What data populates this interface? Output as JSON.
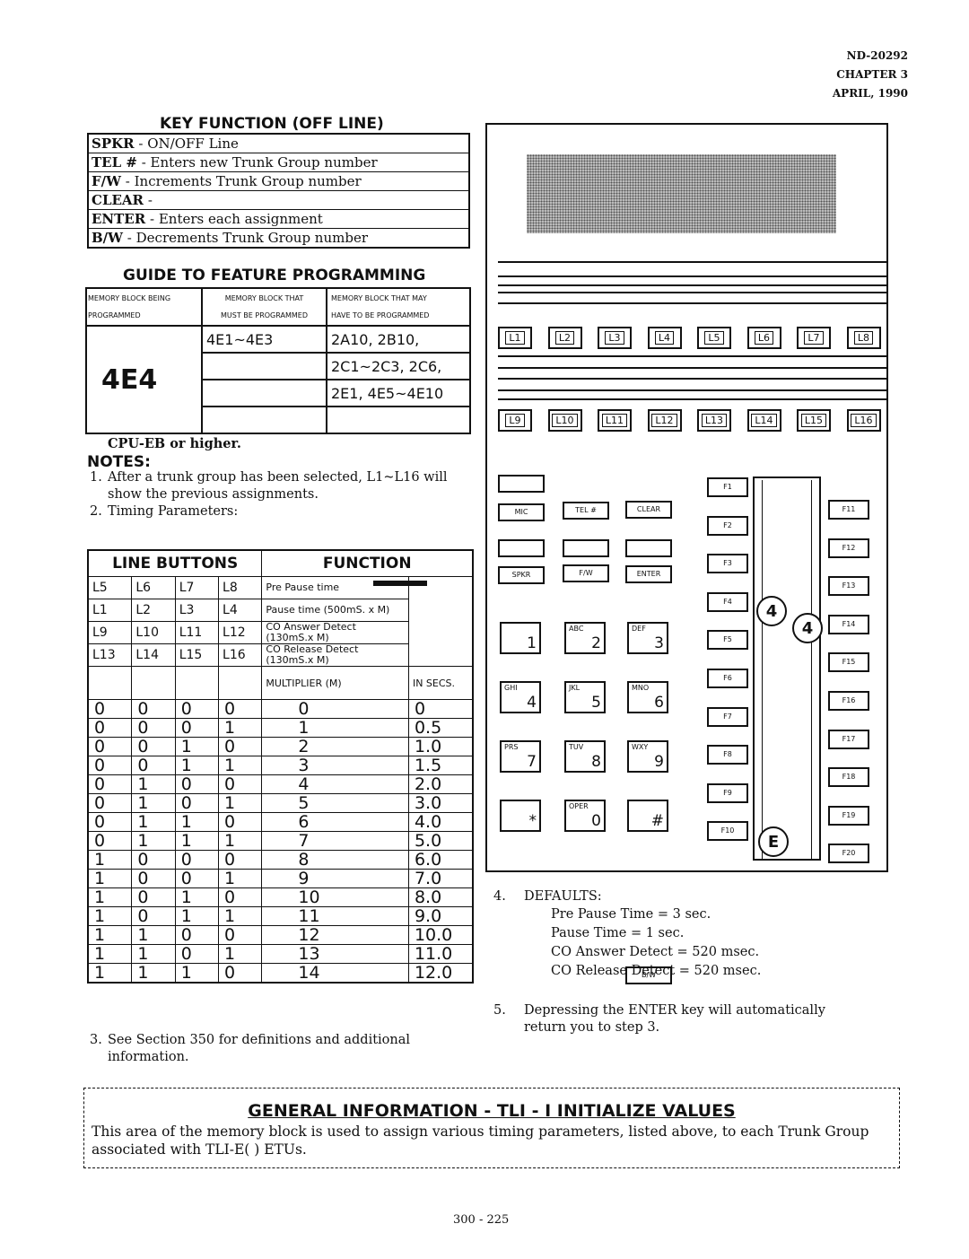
{
  "header": {
    "doc": "ND-20292",
    "chapter": "CHAPTER 3",
    "date": "APRIL, 1990"
  },
  "key_function": {
    "title": "KEY FUNCTION (OFF LINE)",
    "rows": [
      {
        "key": "SPKR",
        "desc": "- ON/OFF Line"
      },
      {
        "key": "TEL #",
        "desc": "- Enters new Trunk Group number"
      },
      {
        "key": "F/W",
        "desc": "- Increments Trunk Group number"
      },
      {
        "key": "CLEAR",
        "desc": "-"
      },
      {
        "key": "ENTER",
        "desc": "- Enters each assignment"
      },
      {
        "key": "B/W",
        "desc": "- Decrements Trunk Group number"
      }
    ]
  },
  "guide": {
    "title": "GUIDE TO FEATURE PROGRAMMING",
    "col1": [
      "MEMORY BLOCK BEING",
      "PROGRAMMED"
    ],
    "col2": [
      "MEMORY BLOCK THAT",
      "MUST BE PROGRAMMED"
    ],
    "col3": [
      "MEMORY BLOCK THAT MAY",
      "HAVE TO BE PROGRAMMED"
    ],
    "block": "4E4",
    "must": [
      "4E1~4E3",
      "",
      "",
      ""
    ],
    "may": [
      "2A10, 2B10,",
      "2C1~2C3, 2C6,",
      "2E1, 4E5~4E10",
      ""
    ]
  },
  "cpu_note": "CPU-EB or higher.",
  "notes_title": "NOTES:",
  "notes": [
    {
      "n": "1.",
      "t": "After a trunk group has been selected, L1~L16 will show the previous assignments."
    },
    {
      "n": "2.",
      "t": "Timing Parameters:"
    }
  ],
  "line_buttons": {
    "h1": "LINE BUTTONS",
    "h2": "FUNCTION",
    "rows": [
      {
        "b": [
          "L5",
          "L6",
          "L7",
          "L8"
        ],
        "f": "Pre Pause time"
      },
      {
        "b": [
          "L1",
          "L2",
          "L3",
          "L4"
        ],
        "f": "Pause time (500mS. x M)"
      },
      {
        "b": [
          "L9",
          "L10",
          "L11",
          "L12"
        ],
        "f": "CO Answer Detect (130mS.x M)"
      },
      {
        "b": [
          "L13",
          "L14",
          "L15",
          "L16"
        ],
        "f": "CO Release Detect (130mS.x M)"
      }
    ],
    "mult": "MULTIPLIER (M)",
    "unit": "IN SECS.",
    "data": [
      [
        "0",
        "0",
        "0",
        "0",
        "0",
        "0"
      ],
      [
        "0",
        "0",
        "0",
        "1",
        "1",
        "0.5"
      ],
      [
        "0",
        "0",
        "1",
        "0",
        "2",
        "1.0"
      ],
      [
        "0",
        "0",
        "1",
        "1",
        "3",
        "1.5"
      ],
      [
        "0",
        "1",
        "0",
        "0",
        "4",
        "2.0"
      ],
      [
        "0",
        "1",
        "0",
        "1",
        "5",
        "3.0"
      ],
      [
        "0",
        "1",
        "1",
        "0",
        "6",
        "4.0"
      ],
      [
        "0",
        "1",
        "1",
        "1",
        "7",
        "5.0"
      ],
      [
        "1",
        "0",
        "0",
        "0",
        "8",
        "6.0"
      ],
      [
        "1",
        "0",
        "0",
        "1",
        "9",
        "7.0"
      ],
      [
        "1",
        "0",
        "1",
        "0",
        "10",
        "8.0"
      ],
      [
        "1",
        "0",
        "1",
        "1",
        "11",
        "9.0"
      ],
      [
        "1",
        "1",
        "0",
        "0",
        "12",
        "10.0"
      ],
      [
        "1",
        "1",
        "0",
        "1",
        "13",
        "11.0"
      ],
      [
        "1",
        "1",
        "1",
        "0",
        "14",
        "12.0"
      ]
    ]
  },
  "note3": {
    "n": "3.",
    "t": "See Section 350 for definitions and additional information."
  },
  "phone": {
    "line_keys_1": [
      "L1",
      "L2",
      "L3",
      "L4",
      "L5",
      "L6",
      "L7",
      "L8"
    ],
    "line_keys_2": [
      "L9",
      "L10",
      "L11",
      "L12",
      "L13",
      "L14",
      "L15",
      "L16"
    ],
    "func_keys": [
      "MIC",
      "TEL #",
      "CLEAR",
      "SPKR",
      "F/W",
      "ENTER",
      "B/W"
    ],
    "dial": [
      {
        "l": "",
        "n": "1"
      },
      {
        "l": "ABC",
        "n": "2"
      },
      {
        "l": "DEF",
        "n": "3"
      },
      {
        "l": "GHI",
        "n": "4"
      },
      {
        "l": "JKL",
        "n": "5"
      },
      {
        "l": "MNO",
        "n": "6"
      },
      {
        "l": "PRS",
        "n": "7"
      },
      {
        "l": "TUV",
        "n": "8"
      },
      {
        "l": "WXY",
        "n": "9"
      },
      {
        "l": "",
        "n": "*"
      },
      {
        "l": "OPER",
        "n": "0"
      },
      {
        "l": "",
        "n": "#"
      }
    ],
    "f_left": [
      "F1",
      "F2",
      "F3",
      "F4",
      "F5",
      "F6",
      "F7",
      "F8",
      "F9",
      "F10"
    ],
    "f_right": [
      "F11",
      "F12",
      "F13",
      "F14",
      "F15",
      "F16",
      "F17",
      "F18",
      "F19",
      "F20"
    ],
    "markers": [
      "4",
      "4",
      "E"
    ]
  },
  "defaults": {
    "n": "4.",
    "title": "DEFAULTS:",
    "items": [
      "Pre Pause Time = 3 sec.",
      "Pause Time = 1 sec.",
      "CO Answer Detect = 520 msec.",
      "CO Release Detect = 520 msec."
    ]
  },
  "note5": {
    "n": "5.",
    "t": "Depressing the ENTER key will automatically return you to step 3."
  },
  "general": {
    "title": "GENERAL INFORMATION - TLI - I INITIALIZE VALUES",
    "text": "This area of the memory block is used to assign various timing parameters, listed above, to each Trunk Group associated with TLI-E( ) ETUs."
  },
  "page_number": "300 - 225"
}
